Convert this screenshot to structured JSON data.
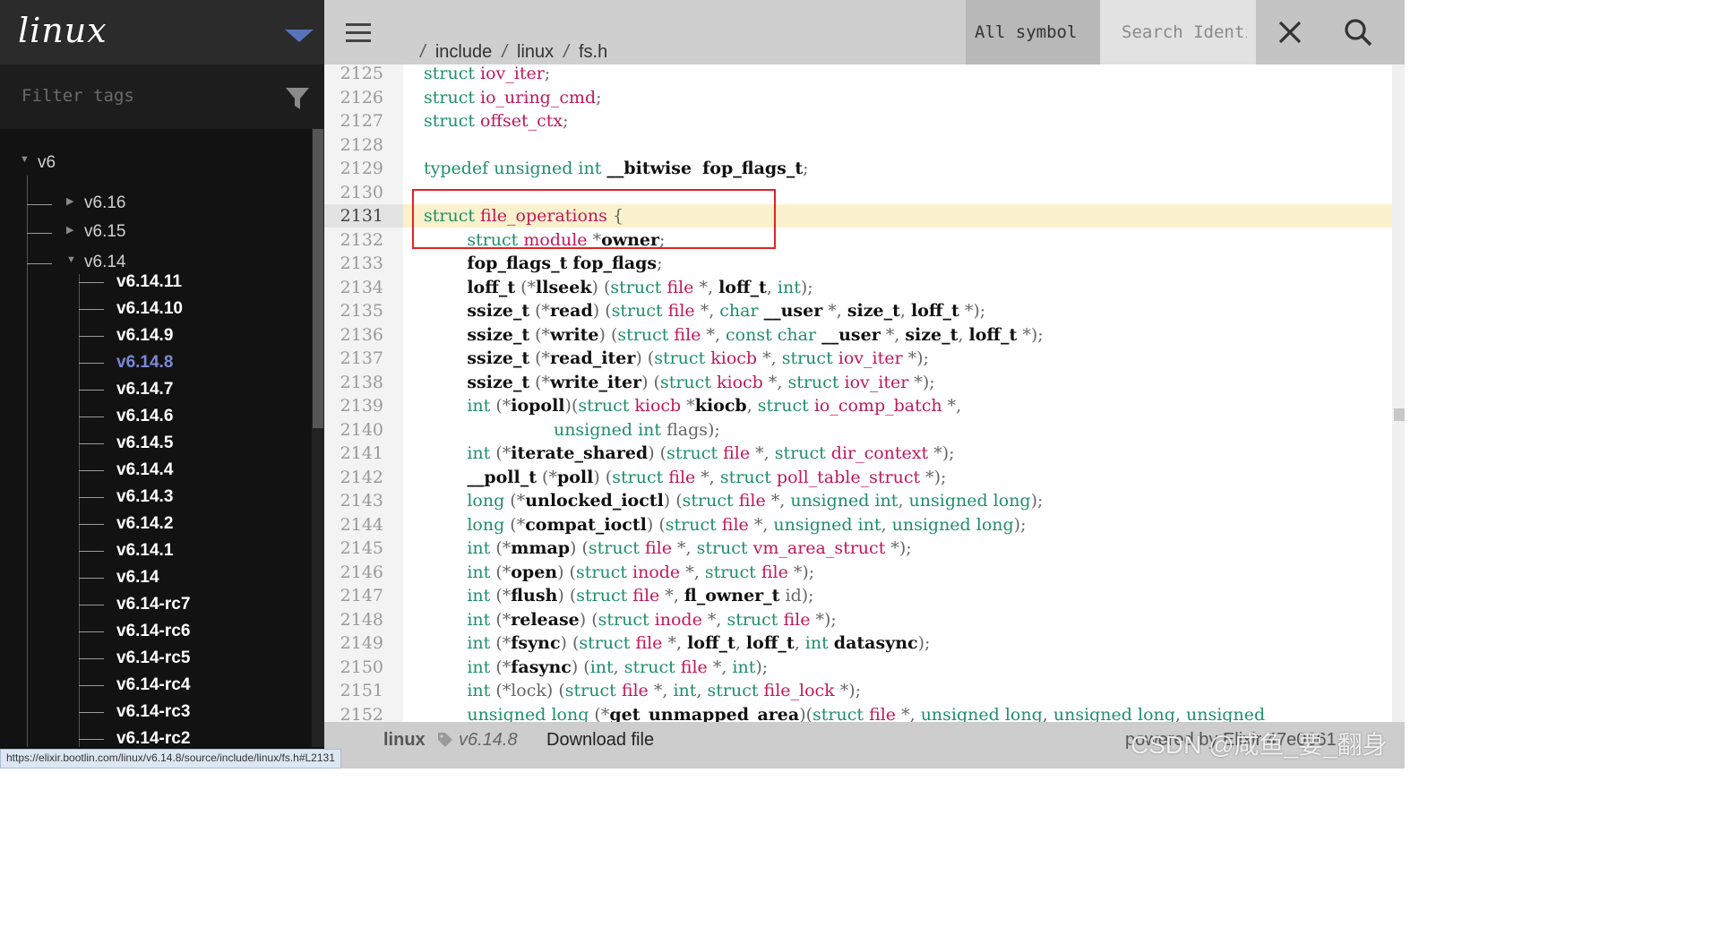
{
  "sidebar": {
    "project": "linux",
    "filter_placeholder": "Filter tags",
    "major": "v6",
    "groups": [
      "v6.16",
      "v6.15",
      "v6.14"
    ],
    "versions": [
      "v6.14.11",
      "v6.14.10",
      "v6.14.9",
      "v6.14.8",
      "v6.14.7",
      "v6.14.6",
      "v6.14.5",
      "v6.14.4",
      "v6.14.3",
      "v6.14.2",
      "v6.14.1",
      "v6.14",
      "v6.14-rc7",
      "v6.14-rc6",
      "v6.14-rc5",
      "v6.14-rc4",
      "v6.14-rc3",
      "v6.14-rc2"
    ],
    "active_version": "v6.14.8"
  },
  "topbar": {
    "breadcrumb": [
      "/",
      "include",
      "linux",
      "fs.h"
    ],
    "symbol_select": "All symbol",
    "search_placeholder": "Search Identifier"
  },
  "code": {
    "highlight_line": "2131",
    "lines": [
      {
        "n": "2125",
        "tokens": [
          [
            "k",
            "struct "
          ],
          [
            "t",
            "iov_iter"
          ],
          [
            "p",
            ";"
          ]
        ]
      },
      {
        "n": "2126",
        "tokens": [
          [
            "k",
            "struct "
          ],
          [
            "t",
            "io_uring_cmd"
          ],
          [
            "p",
            ";"
          ]
        ]
      },
      {
        "n": "2127",
        "tokens": [
          [
            "k",
            "struct "
          ],
          [
            "t",
            "offset_ctx"
          ],
          [
            "p",
            ";"
          ]
        ]
      },
      {
        "n": "2128",
        "tokens": []
      },
      {
        "n": "2129",
        "tokens": [
          [
            "k",
            "typedef unsigned int "
          ],
          [
            "ident",
            "__bitwise"
          ],
          [
            "",
            "  "
          ],
          [
            "ident",
            "fop_flags_t"
          ],
          [
            "p",
            ";"
          ]
        ]
      },
      {
        "n": "2130",
        "tokens": []
      },
      {
        "n": "2131",
        "tokens": [
          [
            "k",
            "struct "
          ],
          [
            "t",
            "file_operations"
          ],
          [
            "p",
            " {"
          ]
        ]
      },
      {
        "n": "2132",
        "tokens": [
          [
            "",
            "        "
          ],
          [
            "k",
            "struct "
          ],
          [
            "t",
            "module"
          ],
          [
            "p",
            " *"
          ],
          [
            "ident",
            "owner"
          ],
          [
            "p",
            ";"
          ]
        ]
      },
      {
        "n": "2133",
        "tokens": [
          [
            "",
            "        "
          ],
          [
            "ident",
            "fop_flags_t"
          ],
          [
            "",
            ""
          ],
          [
            "p",
            " "
          ],
          [
            "ident",
            "fop_flags"
          ],
          [
            "p",
            ";"
          ]
        ]
      },
      {
        "n": "2134",
        "tokens": [
          [
            "",
            "        "
          ],
          [
            "ident",
            "loff_t"
          ],
          [
            "p",
            " (*"
          ],
          [
            "ident",
            "llseek"
          ],
          [
            "p",
            ") ("
          ],
          [
            "k",
            "struct "
          ],
          [
            "t",
            "file"
          ],
          [
            "p",
            " *, "
          ],
          [
            "ident",
            "loff_t"
          ],
          [
            "p",
            ", "
          ],
          [
            "k",
            "int"
          ],
          [
            "p",
            ");"
          ]
        ]
      },
      {
        "n": "2135",
        "tokens": [
          [
            "",
            "        "
          ],
          [
            "ident",
            "ssize_t"
          ],
          [
            "p",
            " (*"
          ],
          [
            "ident",
            "read"
          ],
          [
            "p",
            ") ("
          ],
          [
            "k",
            "struct "
          ],
          [
            "t",
            "file"
          ],
          [
            "p",
            " *, "
          ],
          [
            "k",
            "char "
          ],
          [
            "ident",
            "__user"
          ],
          [
            "p",
            " *, "
          ],
          [
            "ident",
            "size_t"
          ],
          [
            "p",
            ", "
          ],
          [
            "ident",
            "loff_t"
          ],
          [
            "p",
            " *);"
          ]
        ]
      },
      {
        "n": "2136",
        "tokens": [
          [
            "",
            "        "
          ],
          [
            "ident",
            "ssize_t"
          ],
          [
            "p",
            " (*"
          ],
          [
            "ident",
            "write"
          ],
          [
            "p",
            ") ("
          ],
          [
            "k",
            "struct "
          ],
          [
            "t",
            "file"
          ],
          [
            "p",
            " *, "
          ],
          [
            "k",
            "const char "
          ],
          [
            "ident",
            "__user"
          ],
          [
            "p",
            " *, "
          ],
          [
            "ident",
            "size_t"
          ],
          [
            "p",
            ", "
          ],
          [
            "ident",
            "loff_t"
          ],
          [
            "p",
            " *);"
          ]
        ]
      },
      {
        "n": "2137",
        "tokens": [
          [
            "",
            "        "
          ],
          [
            "ident",
            "ssize_t"
          ],
          [
            "p",
            " (*"
          ],
          [
            "ident",
            "read_iter"
          ],
          [
            "p",
            ") ("
          ],
          [
            "k",
            "struct "
          ],
          [
            "t",
            "kiocb"
          ],
          [
            "p",
            " *, "
          ],
          [
            "k",
            "struct "
          ],
          [
            "t",
            "iov_iter"
          ],
          [
            "p",
            " *);"
          ]
        ]
      },
      {
        "n": "2138",
        "tokens": [
          [
            "",
            "        "
          ],
          [
            "ident",
            "ssize_t"
          ],
          [
            "p",
            " (*"
          ],
          [
            "ident",
            "write_iter"
          ],
          [
            "p",
            ") ("
          ],
          [
            "k",
            "struct "
          ],
          [
            "t",
            "kiocb"
          ],
          [
            "p",
            " *, "
          ],
          [
            "k",
            "struct "
          ],
          [
            "t",
            "iov_iter"
          ],
          [
            "p",
            " *);"
          ]
        ]
      },
      {
        "n": "2139",
        "tokens": [
          [
            "",
            "        "
          ],
          [
            "k",
            "int"
          ],
          [
            "p",
            " (*"
          ],
          [
            "ident",
            "iopoll"
          ],
          [
            "p",
            ")("
          ],
          [
            "k",
            "struct "
          ],
          [
            "t",
            "kiocb"
          ],
          [
            "p",
            " *"
          ],
          [
            "ident",
            "kiocb"
          ],
          [
            "p",
            ", "
          ],
          [
            "k",
            "struct "
          ],
          [
            "t",
            "io_comp_batch"
          ],
          [
            "p",
            " *,"
          ]
        ]
      },
      {
        "n": "2140",
        "tokens": [
          [
            "",
            "                        "
          ],
          [
            "k",
            "unsigned int "
          ],
          [
            "p",
            "flags);"
          ]
        ]
      },
      {
        "n": "2141",
        "tokens": [
          [
            "",
            "        "
          ],
          [
            "k",
            "int"
          ],
          [
            "p",
            " (*"
          ],
          [
            "ident",
            "iterate_shared"
          ],
          [
            "p",
            ") ("
          ],
          [
            "k",
            "struct "
          ],
          [
            "t",
            "file"
          ],
          [
            "p",
            " *, "
          ],
          [
            "k",
            "struct "
          ],
          [
            "t",
            "dir_context"
          ],
          [
            "p",
            " *);"
          ]
        ]
      },
      {
        "n": "2142",
        "tokens": [
          [
            "",
            "        "
          ],
          [
            "ident",
            "__poll_t"
          ],
          [
            "p",
            " (*"
          ],
          [
            "ident",
            "poll"
          ],
          [
            "p",
            ") ("
          ],
          [
            "k",
            "struct "
          ],
          [
            "t",
            "file"
          ],
          [
            "p",
            " *, "
          ],
          [
            "k",
            "struct "
          ],
          [
            "t",
            "poll_table_struct"
          ],
          [
            "p",
            " *);"
          ]
        ]
      },
      {
        "n": "2143",
        "tokens": [
          [
            "",
            "        "
          ],
          [
            "k",
            "long"
          ],
          [
            "p",
            " (*"
          ],
          [
            "ident",
            "unlocked_ioctl"
          ],
          [
            "p",
            ") ("
          ],
          [
            "k",
            "struct "
          ],
          [
            "t",
            "file"
          ],
          [
            "p",
            " *, "
          ],
          [
            "k",
            "unsigned int"
          ],
          [
            "p",
            ", "
          ],
          [
            "k",
            "unsigned long"
          ],
          [
            "p",
            ");"
          ]
        ]
      },
      {
        "n": "2144",
        "tokens": [
          [
            "",
            "        "
          ],
          [
            "k",
            "long"
          ],
          [
            "p",
            " (*"
          ],
          [
            "ident",
            "compat_ioctl"
          ],
          [
            "p",
            ") ("
          ],
          [
            "k",
            "struct "
          ],
          [
            "t",
            "file"
          ],
          [
            "p",
            " *, "
          ],
          [
            "k",
            "unsigned int"
          ],
          [
            "p",
            ", "
          ],
          [
            "k",
            "unsigned long"
          ],
          [
            "p",
            ");"
          ]
        ]
      },
      {
        "n": "2145",
        "tokens": [
          [
            "",
            "        "
          ],
          [
            "k",
            "int"
          ],
          [
            "p",
            " (*"
          ],
          [
            "ident",
            "mmap"
          ],
          [
            "p",
            ") ("
          ],
          [
            "k",
            "struct "
          ],
          [
            "t",
            "file"
          ],
          [
            "p",
            " *, "
          ],
          [
            "k",
            "struct "
          ],
          [
            "t",
            "vm_area_struct"
          ],
          [
            "p",
            " *);"
          ]
        ]
      },
      {
        "n": "2146",
        "tokens": [
          [
            "",
            "        "
          ],
          [
            "k",
            "int"
          ],
          [
            "p",
            " (*"
          ],
          [
            "ident",
            "open"
          ],
          [
            "p",
            ") ("
          ],
          [
            "k",
            "struct "
          ],
          [
            "t",
            "inode"
          ],
          [
            "p",
            " *, "
          ],
          [
            "k",
            "struct "
          ],
          [
            "t",
            "file"
          ],
          [
            "p",
            " *);"
          ]
        ]
      },
      {
        "n": "2147",
        "tokens": [
          [
            "",
            "        "
          ],
          [
            "k",
            "int"
          ],
          [
            "p",
            " (*"
          ],
          [
            "ident",
            "flush"
          ],
          [
            "p",
            ") ("
          ],
          [
            "k",
            "struct "
          ],
          [
            "t",
            "file"
          ],
          [
            "p",
            " *, "
          ],
          [
            "ident",
            "fl_owner_t"
          ],
          [
            "p",
            " id);"
          ]
        ]
      },
      {
        "n": "2148",
        "tokens": [
          [
            "",
            "        "
          ],
          [
            "k",
            "int"
          ],
          [
            "p",
            " (*"
          ],
          [
            "ident",
            "release"
          ],
          [
            "p",
            ") ("
          ],
          [
            "k",
            "struct "
          ],
          [
            "t",
            "inode"
          ],
          [
            "p",
            " *, "
          ],
          [
            "k",
            "struct "
          ],
          [
            "t",
            "file"
          ],
          [
            "p",
            " *);"
          ]
        ]
      },
      {
        "n": "2149",
        "tokens": [
          [
            "",
            "        "
          ],
          [
            "k",
            "int"
          ],
          [
            "p",
            " (*"
          ],
          [
            "ident",
            "fsync"
          ],
          [
            "p",
            ") ("
          ],
          [
            "k",
            "struct "
          ],
          [
            "t",
            "file"
          ],
          [
            "p",
            " *, "
          ],
          [
            "ident",
            "loff_t"
          ],
          [
            "p",
            ", "
          ],
          [
            "ident",
            "loff_t"
          ],
          [
            "p",
            ", "
          ],
          [
            "k",
            "int "
          ],
          [
            "ident",
            "datasync"
          ],
          [
            "p",
            ");"
          ]
        ]
      },
      {
        "n": "2150",
        "tokens": [
          [
            "",
            "        "
          ],
          [
            "k",
            "int"
          ],
          [
            "p",
            " (*"
          ],
          [
            "ident",
            "fasync"
          ],
          [
            "p",
            ") ("
          ],
          [
            "k",
            "int"
          ],
          [
            "p",
            ", "
          ],
          [
            "k",
            "struct "
          ],
          [
            "t",
            "file"
          ],
          [
            "p",
            " *, "
          ],
          [
            "k",
            "int"
          ],
          [
            "p",
            ");"
          ]
        ]
      },
      {
        "n": "2151",
        "tokens": [
          [
            "",
            "        "
          ],
          [
            "k",
            "int"
          ],
          [
            "p",
            " (*lock) ("
          ],
          [
            "k",
            "struct "
          ],
          [
            "t",
            "file"
          ],
          [
            "p",
            " *, "
          ],
          [
            "k",
            "int"
          ],
          [
            "p",
            ", "
          ],
          [
            "k",
            "struct "
          ],
          [
            "t",
            "file_lock"
          ],
          [
            "p",
            " *);"
          ]
        ]
      },
      {
        "n": "2152",
        "tokens": [
          [
            "",
            "        "
          ],
          [
            "k",
            "unsigned long"
          ],
          [
            "p",
            " (*"
          ],
          [
            "ident",
            "get_unmapped_area"
          ],
          [
            "p",
            ")("
          ],
          [
            "k",
            "struct "
          ],
          [
            "t",
            "file"
          ],
          [
            "p",
            " *, "
          ],
          [
            "k",
            "unsigned long"
          ],
          [
            "p",
            ", "
          ],
          [
            "k",
            "unsigned long"
          ],
          [
            "p",
            ", "
          ],
          [
            "k",
            "unsigned"
          ]
        ]
      }
    ]
  },
  "footer": {
    "project": "linux",
    "version": "v6.14.8",
    "download_label": "Download file",
    "powered": "powered by Elixir 47e0661",
    "watermark": "CSDN @咸鱼_要_翻身"
  },
  "status_url": "https://elixir.bootlin.com/linux/v6.14.8/source/include/linux/fs.h#L2131",
  "colors": {
    "keyword": "#1e8f6a",
    "type": "#c0185c",
    "highlight": "#fbf1cc",
    "active_version": "#7b89d8",
    "annotation_box": "#e32222"
  },
  "icons": [
    "chevron-down-icon",
    "filter-icon",
    "menu-icon",
    "close-icon",
    "search-icon",
    "tag-icon"
  ]
}
